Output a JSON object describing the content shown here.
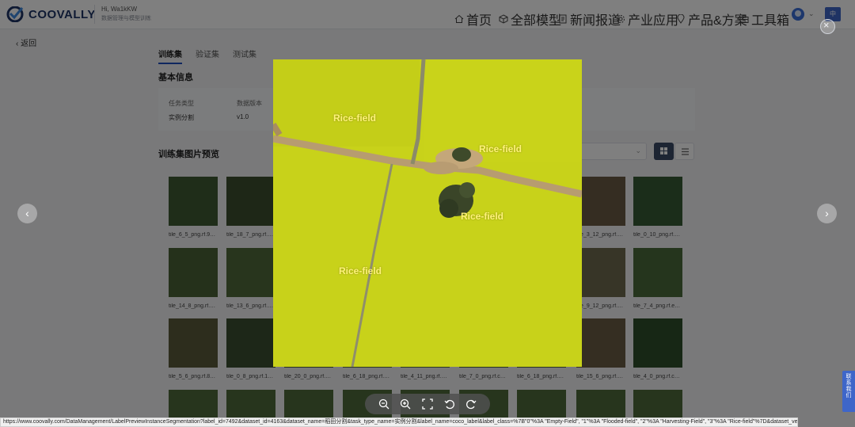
{
  "header": {
    "brand": "COOVALLY",
    "greeting": "Hi, Wa1kKW",
    "greeting_sub": "数据管理与模型训练",
    "nav": [
      {
        "label": "首页",
        "icon": "home-icon"
      },
      {
        "label": "全部模型",
        "icon": "cube-icon"
      },
      {
        "label": "新闻报道",
        "icon": "document-icon"
      },
      {
        "label": "产业应用",
        "icon": "gear-icon"
      },
      {
        "label": "产品&方案",
        "icon": "location-icon"
      },
      {
        "label": "工具箱",
        "icon": "toolbox-icon"
      }
    ],
    "lang_label": "中"
  },
  "page": {
    "back_label": "返回",
    "tabs": [
      {
        "label": "训练集",
        "active": true
      },
      {
        "label": "验证集",
        "active": false
      },
      {
        "label": "测试集",
        "active": false
      }
    ],
    "basic_info_title": "基本信息",
    "info": [
      {
        "label": "任务类型",
        "value": "实例分割"
      },
      {
        "label": "数据版本",
        "value": "v1.0"
      }
    ],
    "preview_title": "训练集图片预览"
  },
  "thumbnails": [
    {
      "label": "tile_6_5_png.rf.9…",
      "color": "#3f5a33"
    },
    {
      "label": "tile_18_7_png.rf.…",
      "color": "#3c4f2e"
    },
    {
      "label": "tile_3_12_png.rf.…",
      "color": "#6b5a44"
    },
    {
      "label": "tile_0_10_png.rf.…",
      "color": "#365a34"
    },
    {
      "label": "tile_14_8_png.rf.…",
      "color": "#4b6337"
    },
    {
      "label": "tile_13_6_png.rf.…",
      "color": "#506b3a"
    },
    {
      "label": "tile_9_12_png.rf.…",
      "color": "#6f6a4f"
    },
    {
      "label": "tile_7_4_png.rf.e…",
      "color": "#4a6a3a"
    },
    {
      "label": "tile_5_6_png.rf.8…",
      "color": "#5a5a3a"
    },
    {
      "label": "tile_0_8_png.rf.1…",
      "color": "#3a4f30"
    },
    {
      "label": "tile_20_0_png.rf.…",
      "color": "#4c6236"
    },
    {
      "label": "tile_6_18_png.rf.…",
      "color": "#5a7040"
    },
    {
      "label": "tile_4_11_png.rf.…",
      "color": "#56703c"
    },
    {
      "label": "tile_7_0_png.rf.c…",
      "color": "#4d6838"
    },
    {
      "label": "tile_6_18_png.rf.…",
      "color": "#52683b"
    },
    {
      "label": "tile_15_6_png.rf.…",
      "color": "#6a5d44"
    },
    {
      "label": "tile_4_0_png.rf.c…",
      "color": "#2f4f2b"
    }
  ],
  "preview": {
    "labels": [
      "Rice-field",
      "Rice-field",
      "Rice-field",
      "Rice-field"
    ],
    "mask_color": "#c8d21a",
    "label_color": "#fff27a"
  },
  "toolbar": {
    "tools": [
      "zoom-out-icon",
      "zoom-in-icon",
      "fullscreen-icon",
      "rotate-left-icon",
      "rotate-right-icon"
    ]
  },
  "status_url": "https://www.coovally.com/DataManagement/LabelPreviewInstanceSegmentation?label_id=7492&dataset_id=4163&dataset_name=稻田分割&task_type_name=实例分割&label_name=coco_label&label_class=%7B\"0\"%3A \"Empty-Field\", \"1\"%3A \"Flooded-field\", \"2\"%3A \"Harvesting-Field\", \"3\"%3A \"Rice-field\"%7D&dataset_version=v1.0#",
  "contact": {
    "label": "联系我们"
  }
}
